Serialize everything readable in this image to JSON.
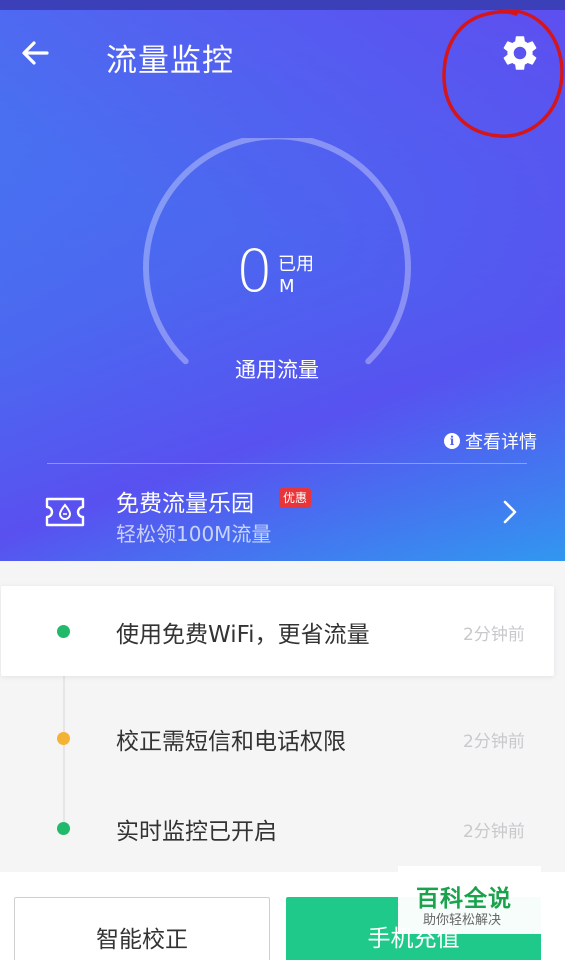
{
  "header": {
    "title": "流量监控",
    "back_icon": "arrow-left-icon",
    "settings_icon": "gear-icon"
  },
  "gauge": {
    "value": "0",
    "used_label": "已用",
    "unit": "M",
    "label": "通用流量",
    "fill_fraction": 0
  },
  "detail_link": {
    "icon": "info-icon",
    "info_glyph": "i",
    "label": "查看详情"
  },
  "promo": {
    "icon": "ticket-icon",
    "title": "免费流量乐园",
    "badge": "优惠",
    "subtitle": "轻松领100M流量"
  },
  "events": [
    {
      "text": "使用免费WiFi，更省流量",
      "time": "2分钟前",
      "dot_color": "#22b96b"
    },
    {
      "text": "校正需短信和电话权限",
      "time": "2分钟前",
      "dot_color": "#f5b335"
    },
    {
      "text": "实时监控已开启",
      "time": "2分钟前",
      "dot_color": "#22b96b"
    }
  ],
  "buttons": {
    "calibrate": "智能校正",
    "recharge": "手机充值"
  },
  "watermark": {
    "title": "百科全说",
    "subtitle": "助你轻松解决"
  },
  "colors": {
    "accent_green": "#1ec98a",
    "badge_red": "#e8353a",
    "annotation_red": "#d4151c"
  }
}
